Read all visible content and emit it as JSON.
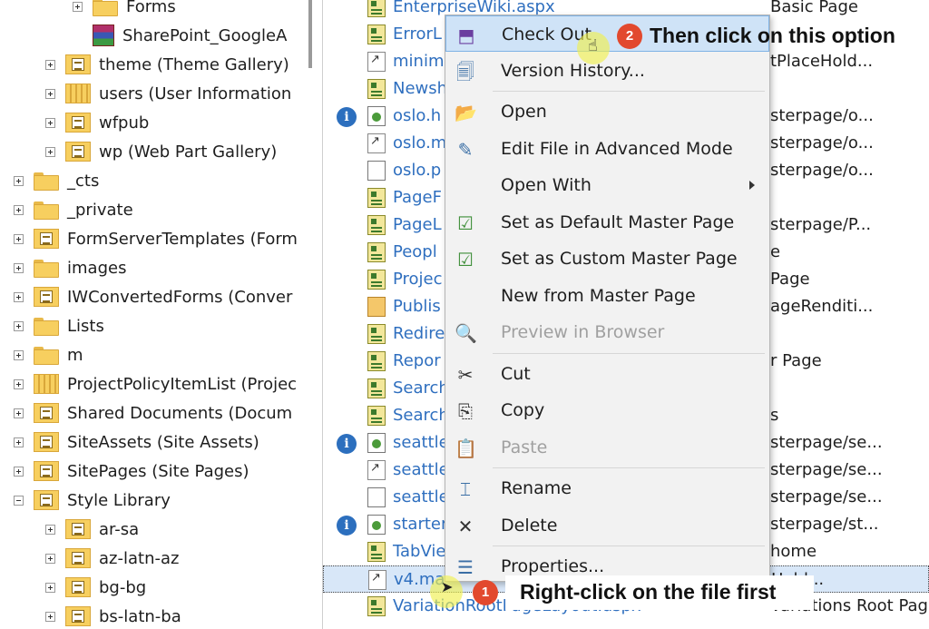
{
  "tree": {
    "items": [
      {
        "label": "Forms",
        "icon": "folder",
        "indent": 2,
        "expander": "plus"
      },
      {
        "label": "SharePoint_GoogleA",
        "icon": "rar-archive",
        "indent": 2,
        "expander": "none"
      },
      {
        "label": "theme (Theme Gallery)",
        "icon": "library",
        "indent": 1,
        "expander": "plus"
      },
      {
        "label": "users (User Information",
        "icon": "list",
        "indent": 1,
        "expander": "plus"
      },
      {
        "label": "wfpub",
        "icon": "library",
        "indent": 1,
        "expander": "plus"
      },
      {
        "label": "wp (Web Part Gallery)",
        "icon": "library",
        "indent": 1,
        "expander": "plus"
      },
      {
        "label": "_cts",
        "icon": "folder",
        "indent": 0,
        "expander": "plus"
      },
      {
        "label": "_private",
        "icon": "folder",
        "indent": 0,
        "expander": "plus"
      },
      {
        "label": "FormServerTemplates (Form",
        "icon": "library",
        "indent": 0,
        "expander": "plus"
      },
      {
        "label": "images",
        "icon": "folder",
        "indent": 0,
        "expander": "plus"
      },
      {
        "label": "IWConvertedForms (Conver",
        "icon": "library",
        "indent": 0,
        "expander": "plus"
      },
      {
        "label": "Lists",
        "icon": "folder",
        "indent": 0,
        "expander": "plus"
      },
      {
        "label": "m",
        "icon": "folder",
        "indent": 0,
        "expander": "plus"
      },
      {
        "label": "ProjectPolicyItemList (Projec",
        "icon": "list",
        "indent": 0,
        "expander": "plus"
      },
      {
        "label": "Shared Documents (Docum",
        "icon": "library",
        "indent": 0,
        "expander": "plus"
      },
      {
        "label": "SiteAssets (Site Assets)",
        "icon": "library",
        "indent": 0,
        "expander": "plus"
      },
      {
        "label": "SitePages (Site Pages)",
        "icon": "library",
        "indent": 0,
        "expander": "plus"
      },
      {
        "label": "Style Library",
        "icon": "library",
        "indent": 0,
        "expander": "minus"
      },
      {
        "label": "ar-sa",
        "icon": "library",
        "indent": 1,
        "expander": "plus"
      },
      {
        "label": "az-latn-az",
        "icon": "library",
        "indent": 1,
        "expander": "plus"
      },
      {
        "label": "bg-bg",
        "icon": "library",
        "indent": 1,
        "expander": "plus"
      },
      {
        "label": "bs-latn-ba",
        "icon": "library",
        "indent": 1,
        "expander": "plus"
      }
    ]
  },
  "files": {
    "rows": [
      {
        "name": "EnterpriseWiki.aspx",
        "title": "Basic Page",
        "icon": "page",
        "info": false
      },
      {
        "name": "ErrorL",
        "title": "",
        "icon": "page",
        "info": false
      },
      {
        "name": "minim",
        "title": "tPlaceHold...",
        "icon": "link",
        "info": false
      },
      {
        "name": "Newsh",
        "title": "",
        "icon": "page",
        "info": false
      },
      {
        "name": "oslo.h",
        "title": "sterpage/o...",
        "icon": "master",
        "info": true
      },
      {
        "name": "oslo.m",
        "title": "sterpage/o...",
        "icon": "link",
        "info": false
      },
      {
        "name": "oslo.p",
        "title": "sterpage/o...",
        "icon": "doc",
        "info": false
      },
      {
        "name": "PageF",
        "title": "",
        "icon": "page",
        "info": false
      },
      {
        "name": "PageL",
        "title": "sterpage/P...",
        "icon": "page",
        "info": false
      },
      {
        "name": "Peopl",
        "title": "e",
        "icon": "page",
        "info": false
      },
      {
        "name": "Projec",
        "title": "Page",
        "icon": "page",
        "info": false
      },
      {
        "name": "Publis",
        "title": "ageRenditi...",
        "icon": "pub",
        "info": false
      },
      {
        "name": "Redire",
        "title": "",
        "icon": "page",
        "info": false
      },
      {
        "name": "Repor",
        "title": "r Page",
        "icon": "page",
        "info": false
      },
      {
        "name": "Search",
        "title": "",
        "icon": "page",
        "info": false
      },
      {
        "name": "Search",
        "title": "s",
        "icon": "page",
        "info": false
      },
      {
        "name": "seattle",
        "title": "sterpage/se...",
        "icon": "master",
        "info": true
      },
      {
        "name": "seattle",
        "title": "sterpage/se...",
        "icon": "link",
        "info": false
      },
      {
        "name": "seattle",
        "title": "sterpage/se...",
        "icon": "doc",
        "info": false
      },
      {
        "name": "starter",
        "title": "sterpage/st...",
        "icon": "master",
        "info": true
      },
      {
        "name": "TabVie",
        "title": "home",
        "icon": "page",
        "info": false
      },
      {
        "name": "v4.ma",
        "title": "Hold...",
        "icon": "link",
        "info": false,
        "selected": true
      },
      {
        "name": "VariationRootPageLayout.aspx",
        "title": "Variations Root Page",
        "icon": "page",
        "info": false
      }
    ]
  },
  "context_menu": {
    "items": [
      {
        "id": "check-out",
        "label": "Check Out",
        "icon": "check-out-icon",
        "glyph": "⬒",
        "color": "#6b3fa0",
        "highlighted": true
      },
      {
        "id": "version-history",
        "label": "Version History...",
        "icon": "version-history-icon",
        "glyph": "🗐",
        "color": "#3a6ea5"
      },
      {
        "id": "sep1",
        "separator": true
      },
      {
        "id": "open",
        "label": "Open",
        "icon": "folder-open-icon",
        "glyph": "📂",
        "color": "#e5a93a"
      },
      {
        "id": "edit-advanced",
        "label": "Edit File in Advanced Mode",
        "icon": "edit-file-icon",
        "glyph": "✎",
        "color": "#3a6ea5"
      },
      {
        "id": "open-with",
        "label": "Open With",
        "icon": "",
        "glyph": "",
        "submenu": true
      },
      {
        "id": "set-default-master",
        "label": "Set as Default Master Page",
        "icon": "set-default-master-icon",
        "glyph": "☑",
        "color": "#3f8f3a"
      },
      {
        "id": "set-custom-master",
        "label": "Set as Custom Master Page",
        "icon": "set-custom-master-icon",
        "glyph": "☑",
        "color": "#3f8f3a"
      },
      {
        "id": "new-from-master",
        "label": "New from Master Page",
        "icon": "",
        "glyph": ""
      },
      {
        "id": "preview",
        "label": "Preview in Browser",
        "icon": "preview-icon",
        "glyph": "🔍",
        "color": "#b0b0b0",
        "disabled": true
      },
      {
        "id": "sep2",
        "separator": true
      },
      {
        "id": "cut",
        "label": "Cut",
        "icon": "scissors-icon",
        "glyph": "✂",
        "color": "#333"
      },
      {
        "id": "copy",
        "label": "Copy",
        "icon": "copy-icon",
        "glyph": "⎘",
        "color": "#333"
      },
      {
        "id": "paste",
        "label": "Paste",
        "icon": "paste-icon",
        "glyph": "📋",
        "color": "#b0b0b0",
        "disabled": true
      },
      {
        "id": "sep3",
        "separator": true
      },
      {
        "id": "rename",
        "label": "Rename",
        "icon": "rename-icon",
        "glyph": "⌶",
        "color": "#3a6ea5"
      },
      {
        "id": "delete",
        "label": "Delete",
        "icon": "delete-icon",
        "glyph": "✕",
        "color": "#333"
      },
      {
        "id": "sep4",
        "separator": true
      },
      {
        "id": "properties",
        "label": "Properties...",
        "icon": "properties-icon",
        "glyph": "☰",
        "color": "#3a6ea5"
      }
    ]
  },
  "annotations": {
    "step1": {
      "number": "1",
      "text": "Right-click on the file first"
    },
    "step2": {
      "number": "2",
      "text": "Then click on this option"
    }
  },
  "colors": {
    "link_text": "#2f6fbf",
    "callout_red": "#e2492e",
    "menu_highlight": "#cfe3f7",
    "selected_row": "#d8e7f8"
  }
}
